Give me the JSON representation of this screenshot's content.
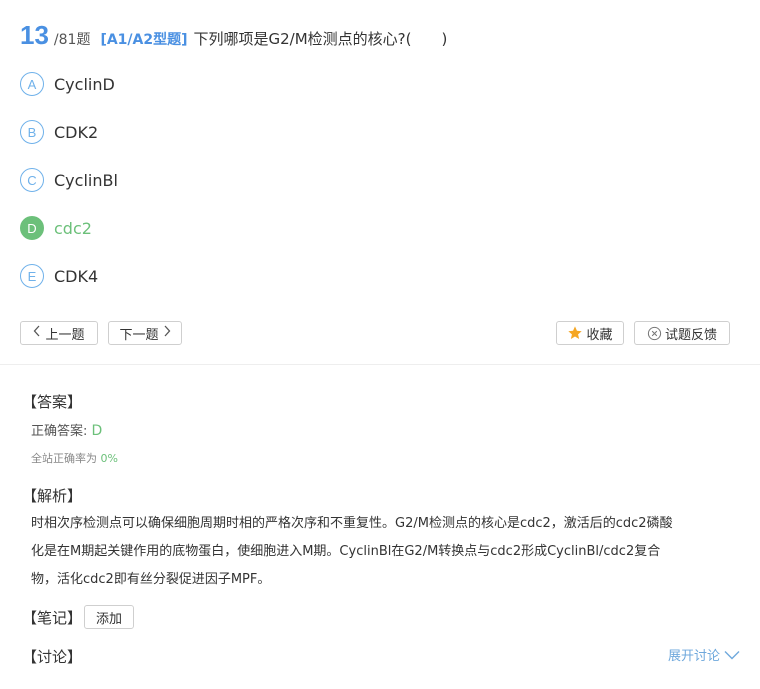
{
  "question": {
    "number": "13",
    "total": "/81题",
    "type": "[A1/A2型题]",
    "text": "下列哪项是G2/M检测点的核心?(　　)"
  },
  "options": [
    {
      "letter": "A",
      "text": "CyclinD",
      "correct": false
    },
    {
      "letter": "B",
      "text": "CDK2",
      "correct": false
    },
    {
      "letter": "C",
      "text": "CyclinBl",
      "correct": false
    },
    {
      "letter": "D",
      "text": "cdc2",
      "correct": true
    },
    {
      "letter": "E",
      "text": "CDK4",
      "correct": false
    }
  ],
  "nav": {
    "prev": "上一题",
    "next": "下一题",
    "favorite": "收藏",
    "feedback": "试题反馈"
  },
  "answer": {
    "title": "【答案】",
    "label": "正确答案:",
    "value": "D",
    "rate_label": "全站正确率为",
    "rate_value": "0%"
  },
  "analysis": {
    "title": "【解析】",
    "lines": [
      "时相次序检测点可以确保细胞周期时相的严格次序和不重复性。G2/M检测点的核心是cdc2，激活后的cdc2磷酸",
      "化是在M期起关键作用的底物蛋白，使细胞进入M期。CyclinBl在G2/M转换点与cdc2形成CyclinBl/cdc2复合",
      "物，活化cdc2即有丝分裂促进因子MPF。"
    ]
  },
  "notes": {
    "title": "【笔记】",
    "add": "添加"
  },
  "discussion": {
    "title": "【讨论】",
    "expand": "展开讨论"
  },
  "colors": {
    "accent_blue": "#4a90e2",
    "correct_green": "#6cc07a",
    "star_orange": "#f5a623"
  }
}
